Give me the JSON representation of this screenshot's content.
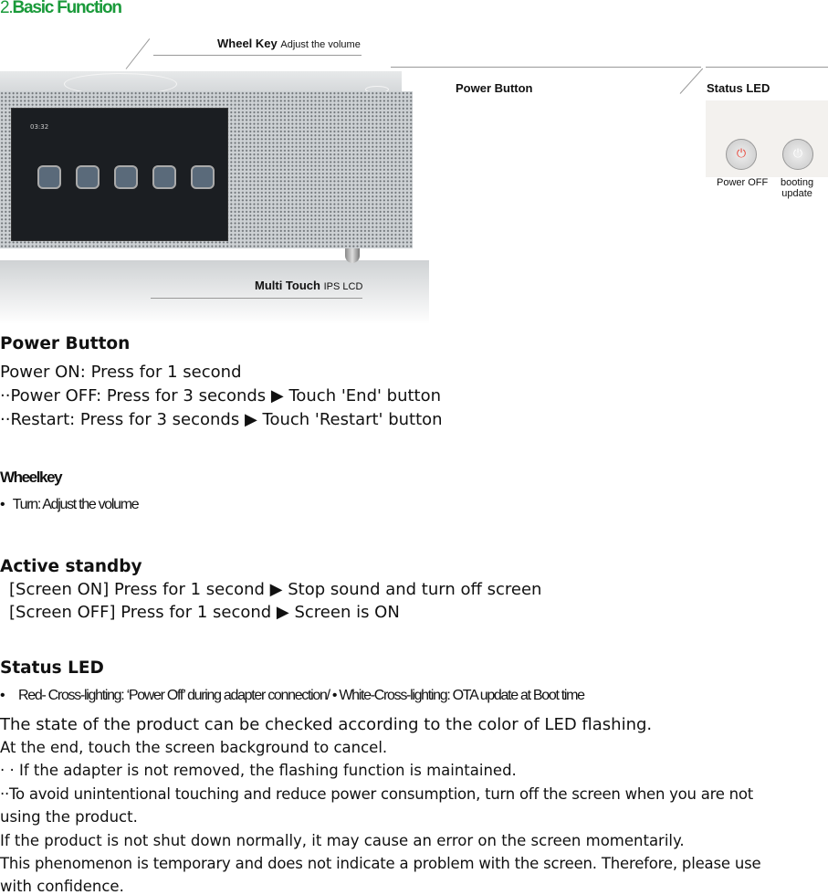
{
  "section_number": "2.",
  "section_title": "Basic Function",
  "figure": {
    "wheel_key_label": "Wheel Key",
    "wheel_key_desc": "Adjust the volume",
    "power_button_label": "Power Button",
    "status_led_label": "Status LED",
    "multi_touch_label": "Multi Touch",
    "multi_touch_desc": "IPS LCD",
    "led_power_off": "Power OFF",
    "led_booting_1": "booting",
    "led_booting_2": "update",
    "led_colors": {
      "power_off": "#e8463a",
      "booting": "#ffffff"
    },
    "screen_time": "03:32"
  },
  "power_button": {
    "heading": "Power Button",
    "lines": [
      "Power ON: Press for 1 second",
      "··Power OFF: Press for 3 seconds ▶ Touch 'End' button",
      "··Restart: Press for 3 seconds ▶ Touch 'Restart' button"
    ]
  },
  "wheel_key": {
    "heading": "Wheelkey",
    "bullet": "•",
    "item": "Turn: Adjust the volume"
  },
  "active_standby": {
    "heading": "Active standby",
    "lines": [
      "[Screen ON] Press for 1 second ▶ Stop sound and turn off screen",
      "[Screen OFF] Press for 1 second ▶ Screen is ON"
    ]
  },
  "status_led": {
    "heading": "Status LED",
    "bullet": "•",
    "item": "Red- Cross-lighting: ‘Power Off’ during adapter connection/ • White-Cross-lighting: OTA update at Boot time",
    "lines": [
      "The state of the product can be checked according to the color of LED flashing.",
      "At the end, touch the screen background to cancel.",
      "· · If the adapter is not removed, the flashing function is maintained.",
      "··To avoid unintentional touching and reduce power consumption, turn off the screen when you are not",
      "using the product.",
      "If the product is not shut down normally, it may cause an error on the screen momentarily.",
      "This phenomenon is temporary and does not indicate a problem with the screen. Therefore, please use",
      "with confidence."
    ]
  }
}
